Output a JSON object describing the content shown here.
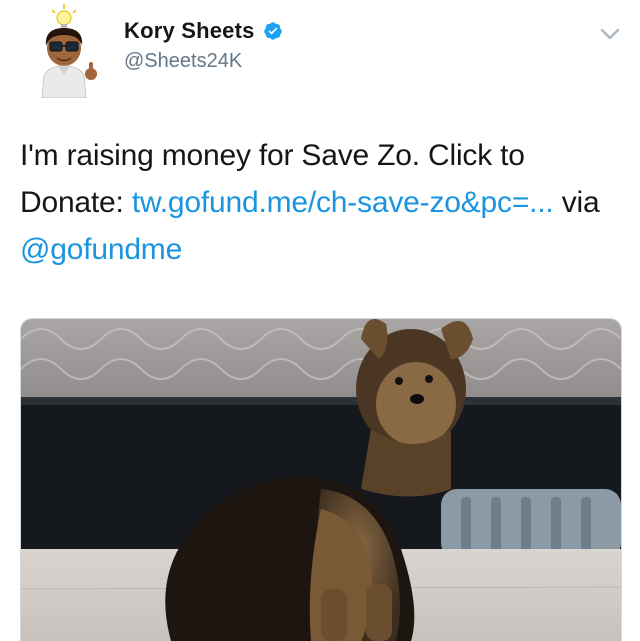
{
  "user": {
    "name": "Kory Sheets",
    "handle": "@Sheets24K",
    "verified": true,
    "avatar_icon": "bitmoji-avatar-lightbulb",
    "verified_icon": "verified-badge-icon",
    "menu_icon": "chevron-down-icon"
  },
  "tweet": {
    "text_before": "I'm raising money for Save Zo. Click to Donate:",
    "link_text": "tw.gofund.me/ch-save-zo&pc=...",
    "text_middle": "via",
    "mention": "@gofundme"
  },
  "colors": {
    "link": "#1b95e0",
    "verified": "#1da1f2",
    "text": "#14171a",
    "secondary": "#657786"
  },
  "media": {
    "type": "photo",
    "subject": "yorkshire-terrier-dog"
  }
}
